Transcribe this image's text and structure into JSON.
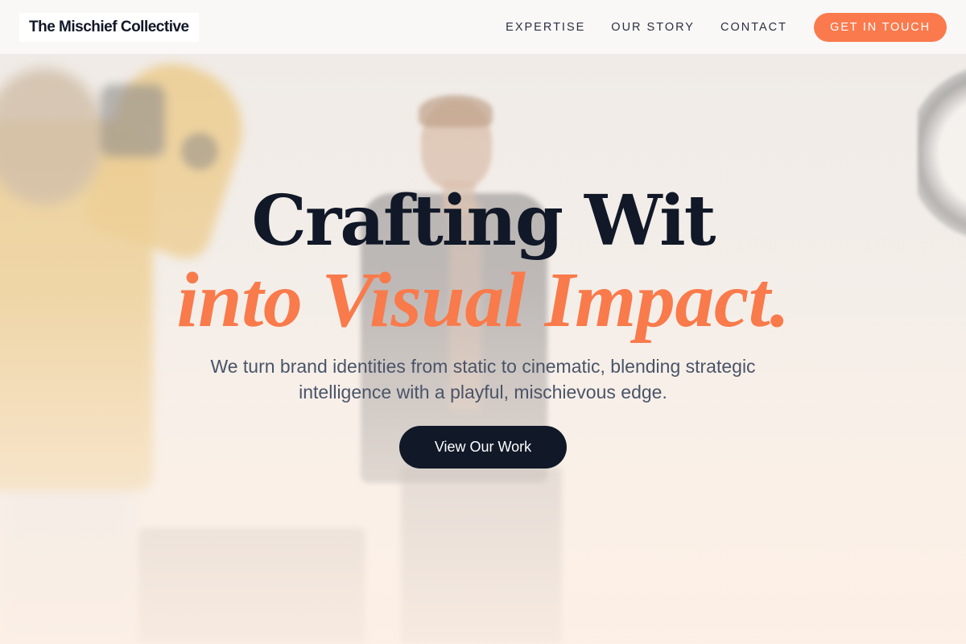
{
  "brand": {
    "name": "The Mischief Collective"
  },
  "nav": {
    "links": [
      "EXPERTISE",
      "OUR STORY",
      "CONTACT"
    ],
    "cta_label": "GET IN TOUCH"
  },
  "hero": {
    "headline_line1": "Crafting Wit",
    "headline_line2": "into Visual Impact.",
    "subtitle": "We turn brand identities from static to cinematic, blending strategic intelligence with a playful, mischievous edge.",
    "cta_label": "View Our Work"
  },
  "colors": {
    "accent": "#fb7a4d",
    "dark": "#111827",
    "text_muted": "#4a5468"
  }
}
